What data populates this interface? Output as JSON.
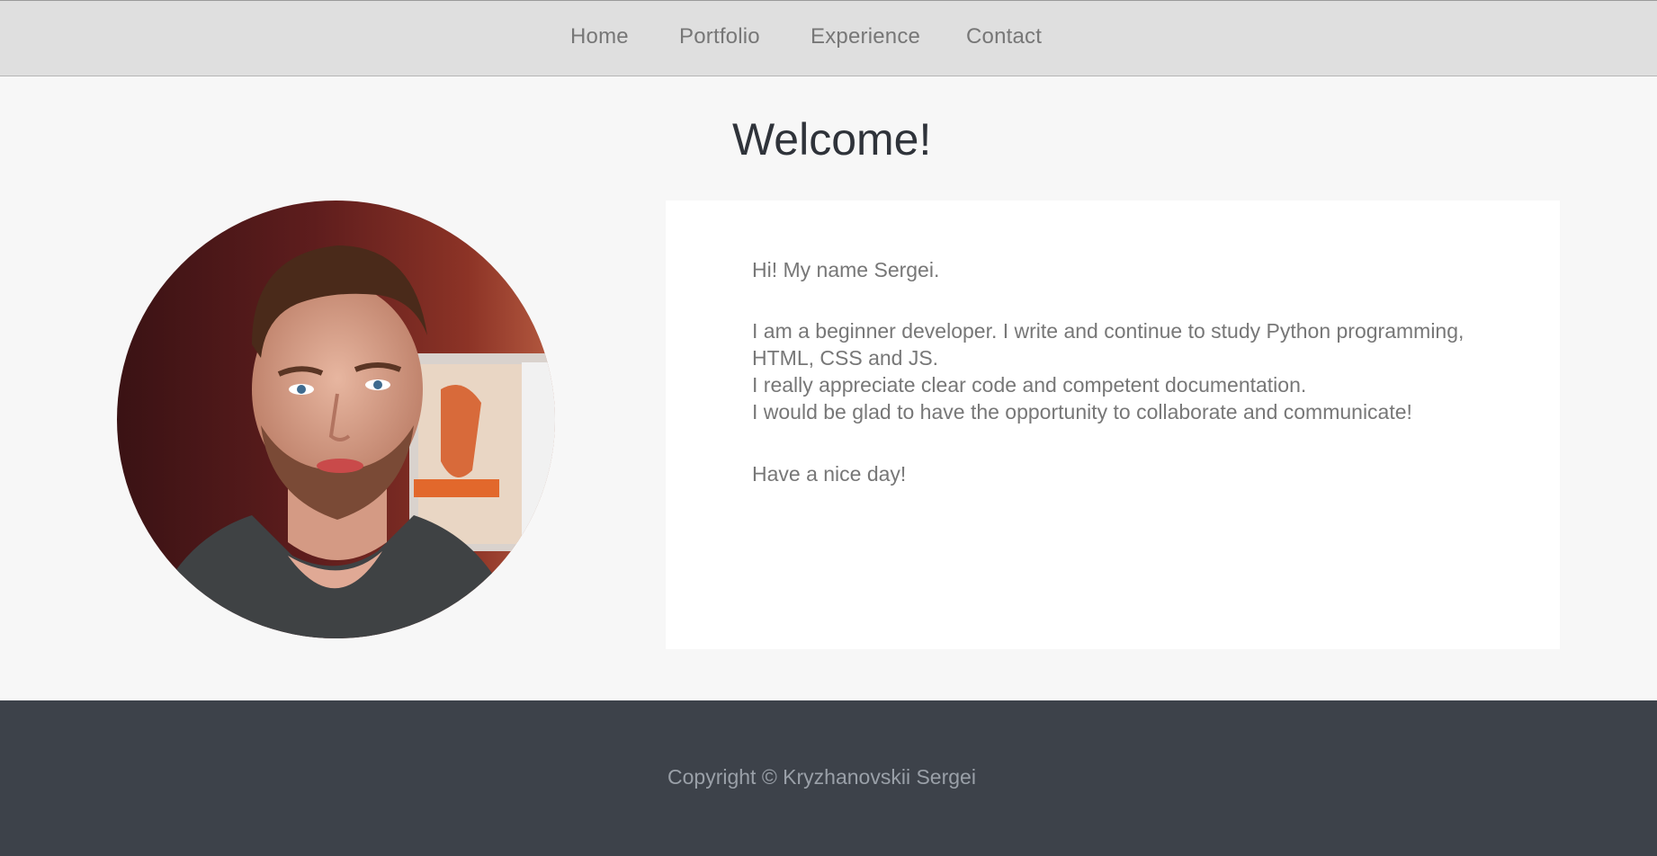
{
  "nav": {
    "home": "Home",
    "portfolio": "Portfolio",
    "experience": "Experience",
    "contact": "Contact"
  },
  "main": {
    "title": "Welcome!",
    "greeting": "Hi! My name Sergei.",
    "bio_line1": "I am a beginner developer. I write and continue to study Python programming,",
    "bio_line2": "HTML, CSS and JS.",
    "bio_line3": "I really appreciate clear code and competent documentation.",
    "bio_line4": "I would be glad to have the opportunity to collaborate and communicate!",
    "closing": "Have a nice day!"
  },
  "footer": {
    "copyright": "Copyright © Kryzhanovskii Sergei"
  },
  "colors": {
    "nav_bg": "#dfdfdf",
    "page_bg": "#f7f7f7",
    "card_bg": "#ffffff",
    "footer_bg": "#3d424a",
    "text_muted": "#777777",
    "title": "#2f333a"
  }
}
